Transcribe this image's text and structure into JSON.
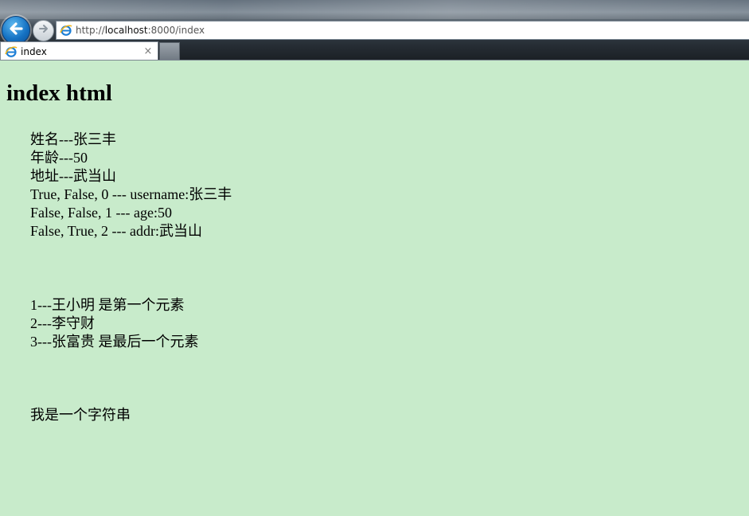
{
  "browser": {
    "url_prefix": "http://",
    "url_host": "localhost",
    "url_rest": ":8000/index",
    "tab_title": "index",
    "tab_close": "×"
  },
  "page": {
    "heading": "index html",
    "user_lines": [
      "姓名---张三丰",
      "年龄---50",
      "地址---武当山",
      "True, False, 0 --- username:张三丰",
      "False, False, 1 --- age:50",
      "False, True, 2 --- addr:武当山"
    ],
    "people_lines": [
      "1---王小明 是第一个元素",
      "2---李守财",
      "3---张富贵 是最后一个元素"
    ],
    "string_line": "我是一个字符串"
  },
  "colors": {
    "page_background": "#c8ebcb",
    "back_button": "#1673c4"
  }
}
